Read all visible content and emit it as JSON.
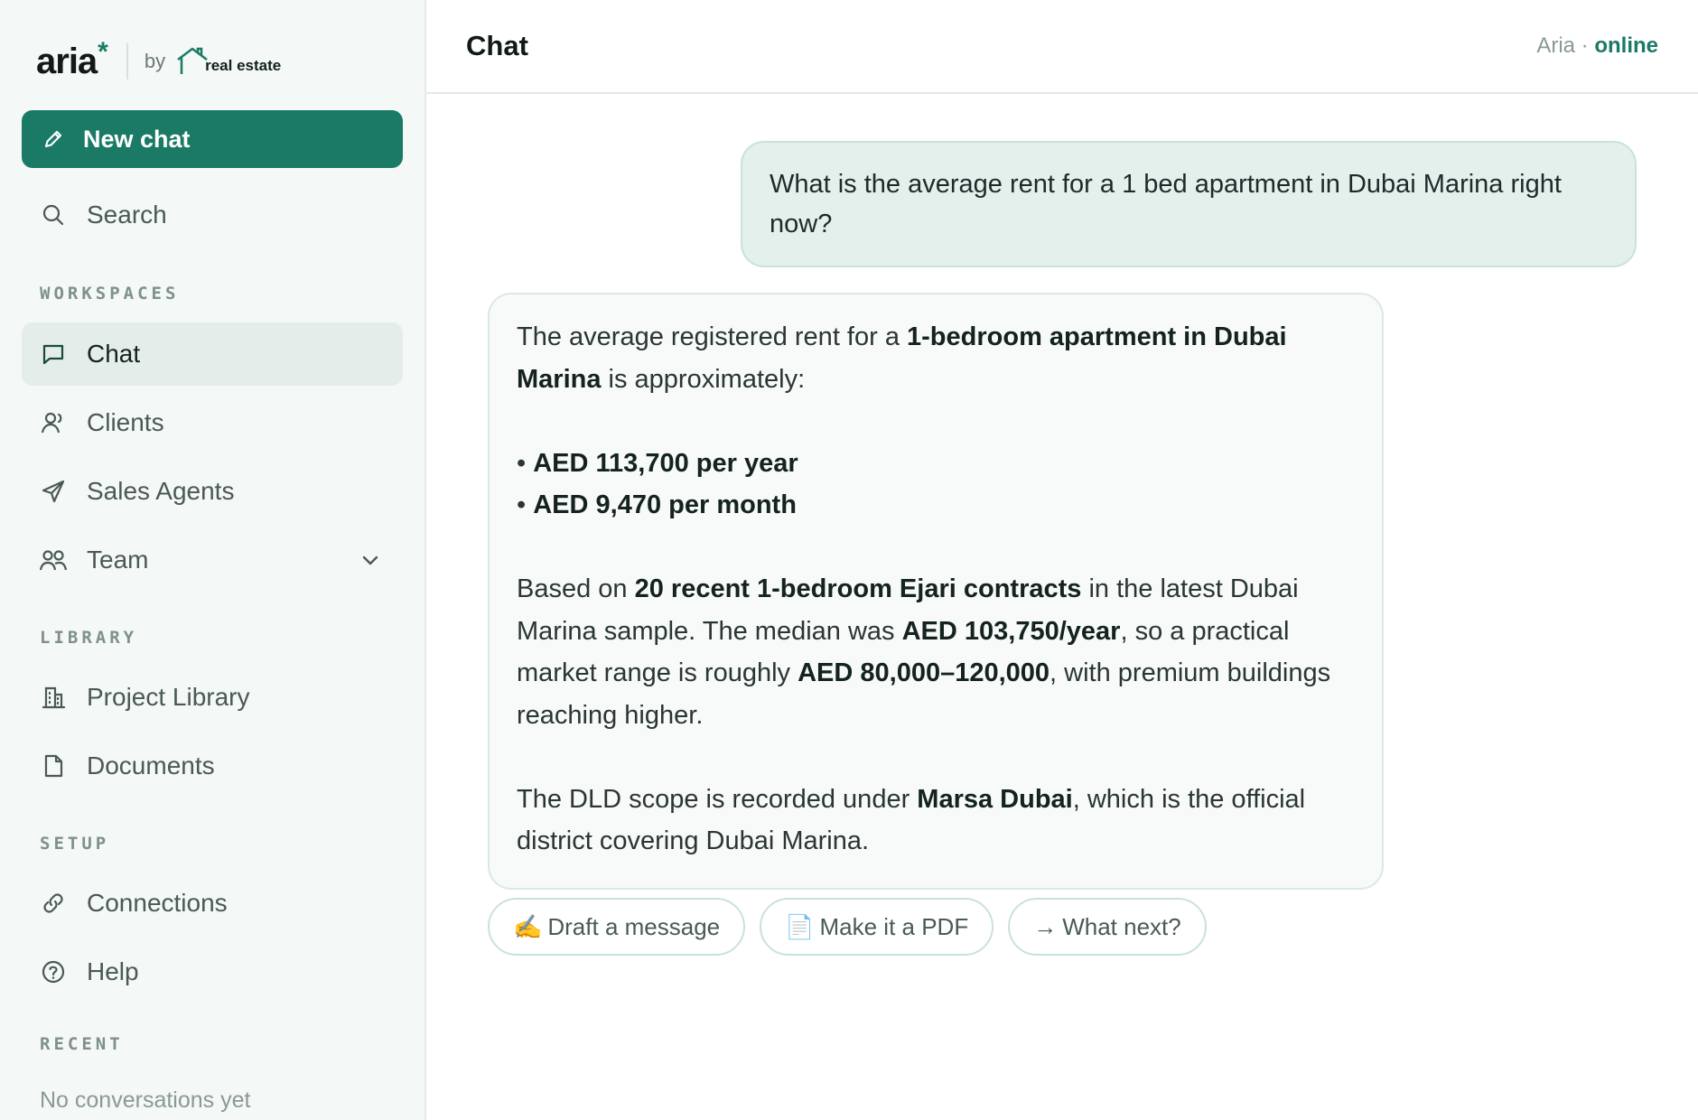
{
  "brand": {
    "name": "aria",
    "star": "*",
    "by": "by",
    "partner_small_top": "DUBAI",
    "partner": "real estate",
    "partner_small_bottom": "ACADEMY"
  },
  "sidebar": {
    "new_chat": "New chat",
    "search": "Search",
    "sections": {
      "workspaces": "WORKSPACES",
      "library": "LIBRARY",
      "setup": "SETUP",
      "recent": "RECENT"
    },
    "items": {
      "chat": "Chat",
      "clients": "Clients",
      "sales_agents": "Sales Agents",
      "team": "Team",
      "project_library": "Project Library",
      "documents": "Documents",
      "connections": "Connections",
      "help": "Help"
    },
    "recent_empty": "No conversations yet"
  },
  "header": {
    "title": "Chat",
    "assistant": "Aria",
    "separator": " · ",
    "status": "online"
  },
  "messages": {
    "user": "What is the average rent for a 1 bed apartment in Dubai Marina right now?",
    "assistant": {
      "p1_a": "The average registered rent for a ",
      "p1_b": "1-bedroom apartment in Dubai Marina",
      "p1_c": " is approximately:",
      "bullet1": "AED 113,700 per year",
      "bullet2": "AED 9,470 per month",
      "p2_a": "Based on ",
      "p2_b": "20 recent 1-bedroom Ejari contracts",
      "p2_c": " in the latest Dubai Marina sample. The median was ",
      "p2_d": "AED 103,750/year",
      "p2_e": ", so a practical market range is roughly ",
      "p2_f": "AED 80,000–120,000",
      "p2_g": ", with premium buildings reaching higher.",
      "p3_a": "The DLD scope is recorded under ",
      "p3_b": "Marsa Dubai",
      "p3_c": ", which is the official district covering Dubai Marina."
    }
  },
  "suggestions": [
    {
      "icon": "✍️",
      "label": "Draft a message"
    },
    {
      "icon": "📄",
      "label": "Make it a PDF"
    },
    {
      "icon": "→",
      "label": "What next?"
    }
  ],
  "colors": {
    "accent": "#1b7a66",
    "sidebar_bg": "#f4f8f6",
    "user_bubble": "#e3f0eb"
  }
}
